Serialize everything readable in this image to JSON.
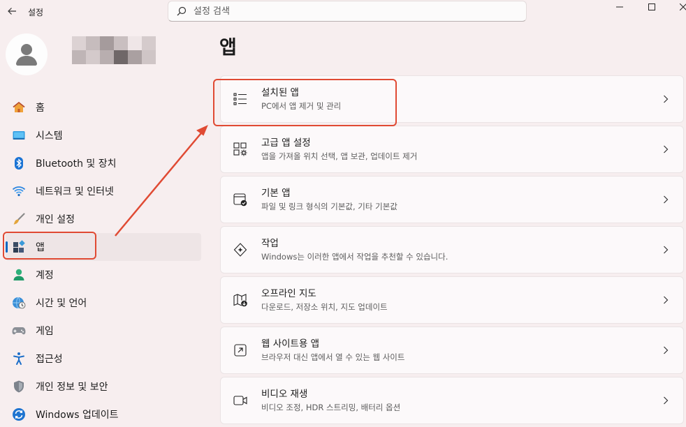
{
  "titlebar": {
    "app_title": "설정",
    "search_placeholder": "설정 검색"
  },
  "profile": {
    "name_pixels": [
      "#dcd2d3",
      "#c6bcbd",
      "#a59b9c",
      "#c9bfc0",
      "#efe6e7",
      "#d5cbcc",
      "#bfb5b6",
      "#d4cacb",
      "#b8aeaf",
      "#6f6768",
      "#aaa0a1",
      "#cfc5c6"
    ]
  },
  "sidebar": {
    "items": [
      {
        "label": "홈",
        "icon": "home-icon"
      },
      {
        "label": "시스템",
        "icon": "system-icon"
      },
      {
        "label": "Bluetooth 및 장치",
        "icon": "bluetooth-icon"
      },
      {
        "label": "네트워크 및 인터넷",
        "icon": "wifi-icon"
      },
      {
        "label": "개인 설정",
        "icon": "brush-icon"
      },
      {
        "label": "앱",
        "icon": "apps-icon",
        "selected": true
      },
      {
        "label": "계정",
        "icon": "account-icon"
      },
      {
        "label": "시간 및 언어",
        "icon": "globe-clock-icon"
      },
      {
        "label": "게임",
        "icon": "gamepad-icon"
      },
      {
        "label": "접근성",
        "icon": "accessibility-icon"
      },
      {
        "label": "개인 정보 및 보안",
        "icon": "shield-icon"
      },
      {
        "label": "Windows 업데이트",
        "icon": "update-icon"
      }
    ]
  },
  "main": {
    "title": "앱",
    "cards": [
      {
        "title": "설치된 앱",
        "subtitle": "PC에서 앱 제거 및 관리",
        "icon": "list-icon"
      },
      {
        "title": "고급 앱 설정",
        "subtitle": "앱을 가져올 위치 선택, 앱 보관, 업데이트 제거",
        "icon": "app-settings-icon"
      },
      {
        "title": "기본 앱",
        "subtitle": "파일 및 링크 형식의 기본값, 기타 기본값",
        "icon": "default-apps-icon"
      },
      {
        "title": "작업",
        "subtitle": "Windows는 이러한 앱에서 작업을 추천할 수 있습니다.",
        "icon": "sparkle-icon"
      },
      {
        "title": "오프라인 지도",
        "subtitle": "다운로드, 저장소 위치, 지도 업데이트",
        "icon": "map-icon"
      },
      {
        "title": "웹 사이트용 앱",
        "subtitle": "브라우저 대신 앱에서 열 수 있는 웹 사이트",
        "icon": "open-external-icon"
      },
      {
        "title": "비디오 재생",
        "subtitle": "비디오 조정, HDR 스트리밍, 배터리 옵션",
        "icon": "video-icon"
      }
    ]
  },
  "colors": {
    "background": "#f7eeef",
    "accent": "#0067c0",
    "annotation": "#e04a33"
  }
}
